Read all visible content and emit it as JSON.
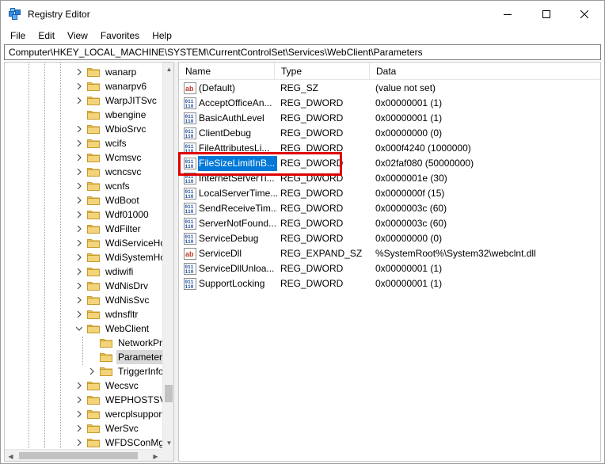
{
  "window": {
    "title": "Registry Editor",
    "controls": {
      "minimize": "minimize",
      "maximize": "maximize",
      "close": "close"
    }
  },
  "menu": [
    "File",
    "Edit",
    "View",
    "Favorites",
    "Help"
  ],
  "address": "Computer\\HKEY_LOCAL_MACHINE\\SYSTEM\\CurrentControlSet\\Services\\WebClient\\Parameters",
  "tree": {
    "items": [
      {
        "label": "wanarp",
        "level": 0,
        "expander": "collapsed"
      },
      {
        "label": "wanarpv6",
        "level": 0,
        "expander": "collapsed"
      },
      {
        "label": "WarpJITSvc",
        "level": 0,
        "expander": "collapsed"
      },
      {
        "label": "wbengine",
        "level": 0,
        "expander": "none"
      },
      {
        "label": "WbioSrvc",
        "level": 0,
        "expander": "collapsed"
      },
      {
        "label": "wcifs",
        "level": 0,
        "expander": "collapsed"
      },
      {
        "label": "Wcmsvc",
        "level": 0,
        "expander": "collapsed"
      },
      {
        "label": "wcncsvc",
        "level": 0,
        "expander": "collapsed"
      },
      {
        "label": "wcnfs",
        "level": 0,
        "expander": "collapsed"
      },
      {
        "label": "WdBoot",
        "level": 0,
        "expander": "collapsed"
      },
      {
        "label": "Wdf01000",
        "level": 0,
        "expander": "collapsed"
      },
      {
        "label": "WdFilter",
        "level": 0,
        "expander": "collapsed"
      },
      {
        "label": "WdiServiceHo",
        "level": 0,
        "expander": "collapsed"
      },
      {
        "label": "WdiSystemHo",
        "level": 0,
        "expander": "collapsed"
      },
      {
        "label": "wdiwifi",
        "level": 0,
        "expander": "collapsed"
      },
      {
        "label": "WdNisDrv",
        "level": 0,
        "expander": "collapsed"
      },
      {
        "label": "WdNisSvc",
        "level": 0,
        "expander": "collapsed"
      },
      {
        "label": "wdnsfltr",
        "level": 0,
        "expander": "collapsed"
      },
      {
        "label": "WebClient",
        "level": 0,
        "expander": "expanded"
      },
      {
        "label": "NetworkPro",
        "level": 1,
        "expander": "none"
      },
      {
        "label": "Parameters",
        "level": 1,
        "expander": "none",
        "selected": true
      },
      {
        "label": "TriggerInfo",
        "level": 1,
        "expander": "collapsed"
      },
      {
        "label": "Wecsvc",
        "level": 0,
        "expander": "collapsed"
      },
      {
        "label": "WEPHOSTSVC",
        "level": 0,
        "expander": "collapsed"
      },
      {
        "label": "wercplsupport",
        "level": 0,
        "expander": "collapsed"
      },
      {
        "label": "WerSvc",
        "level": 0,
        "expander": "collapsed"
      },
      {
        "label": "WFDSConMgr",
        "level": 0,
        "expander": "collapsed"
      }
    ]
  },
  "columns": {
    "name": "Name",
    "type": "Type",
    "data": "Data"
  },
  "values": [
    {
      "icon": "string-value-icon",
      "name": "(Default)",
      "type": "REG_SZ",
      "data": "(value not set)"
    },
    {
      "icon": "binary-value-icon",
      "name": "AcceptOfficeAn...",
      "type": "REG_DWORD",
      "data": "0x00000001 (1)"
    },
    {
      "icon": "binary-value-icon",
      "name": "BasicAuthLevel",
      "type": "REG_DWORD",
      "data": "0x00000001 (1)"
    },
    {
      "icon": "binary-value-icon",
      "name": "ClientDebug",
      "type": "REG_DWORD",
      "data": "0x00000000 (0)"
    },
    {
      "icon": "binary-value-icon",
      "name": "FileAttributesLi...",
      "type": "REG_DWORD",
      "data": "0x000f4240 (1000000)"
    },
    {
      "icon": "binary-value-icon",
      "name": "FileSizeLimitInB...",
      "type": "REG_DWORD",
      "data": "0x02faf080 (50000000)",
      "selected": true
    },
    {
      "icon": "binary-value-icon",
      "name": "InternetServerTi...",
      "type": "REG_DWORD",
      "data": "0x0000001e (30)"
    },
    {
      "icon": "binary-value-icon",
      "name": "LocalServerTime...",
      "type": "REG_DWORD",
      "data": "0x0000000f (15)"
    },
    {
      "icon": "binary-value-icon",
      "name": "SendReceiveTim...",
      "type": "REG_DWORD",
      "data": "0x0000003c (60)"
    },
    {
      "icon": "binary-value-icon",
      "name": "ServerNotFound...",
      "type": "REG_DWORD",
      "data": "0x0000003c (60)"
    },
    {
      "icon": "binary-value-icon",
      "name": "ServiceDebug",
      "type": "REG_DWORD",
      "data": "0x00000000 (0)"
    },
    {
      "icon": "string-value-icon",
      "name": "ServiceDll",
      "type": "REG_EXPAND_SZ",
      "data": "%SystemRoot%\\System32\\webclnt.dll"
    },
    {
      "icon": "binary-value-icon",
      "name": "ServiceDllUnloa...",
      "type": "REG_DWORD",
      "data": "0x00000001 (1)"
    },
    {
      "icon": "binary-value-icon",
      "name": "SupportLocking",
      "type": "REG_DWORD",
      "data": "0x00000001 (1)"
    }
  ],
  "colors": {
    "selection": "#0078d7",
    "highlight_box": "#e00000",
    "folder": "#e8c35a"
  }
}
